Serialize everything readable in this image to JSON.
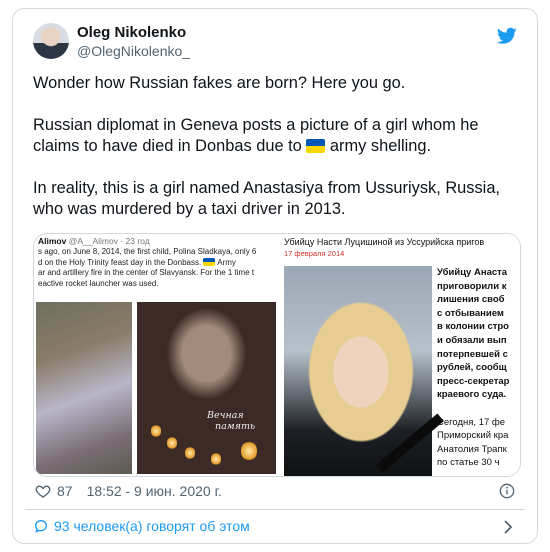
{
  "author": {
    "name": "Oleg Nikolenko",
    "handle": "@OlegNikolenko_"
  },
  "icons": {
    "platform": "twitter-bird-icon",
    "like": "heart-icon",
    "info": "info-icon",
    "replies": "speech-bubble-icon",
    "more": "chevron-right-icon"
  },
  "colors": {
    "accent": "#1d9bf0",
    "flag_top": "#0057b7",
    "flag_bottom": "#ffd700",
    "date_red": "#d0302a"
  },
  "tweet": {
    "p1": "Wonder how Russian fakes are born? Here you go.",
    "p2_before": "Russian diplomat in Geneva posts a picture of a girl whom he claims to have died in Donbas due to",
    "p2_after": "army shelling.",
    "p3": "In reality, this is a girl named Anastasiya from Ussuriysk, Russia, who was murdered by a taxi driver in 2013."
  },
  "media_left": {
    "author": "Alimov",
    "handle": "@A__Alimov · 23 год",
    "lines": [
      "s ago, on June 8, 2014, the first child, Polina Sladkaya, only 6",
      "d on the Holy Trinity feast day in the Donbass.",
      "Army",
      "ar and artillery fire in the center of Slavyansk. For the 1 time t",
      "eactive rocket launcher was used."
    ],
    "memory_line1": "Вечная",
    "memory_line2": "память"
  },
  "media_right": {
    "headline": "Убийцу Насти Луцишиной из Уссурийска пригов",
    "date": "17 февраля 2014",
    "lines": [
      "Убийцу Анаста",
      "приговорили к",
      "лишения своб",
      "с отбыванием",
      "в колонии стро",
      "и обязали вып",
      "потерпевшей с",
      "рублей, сообщ",
      "пресс-секретар",
      "краевого суда.",
      "",
      "Сегодня, 17 фе",
      "Приморский кра",
      "Анатолия Трапк",
      "по статье 30 ч"
    ],
    "bold_count": 10
  },
  "stats": {
    "likes": "87",
    "timestamp": "18:52 - 9 июн. 2020 г."
  },
  "footer": {
    "discussion": "93 человек(а) говорят об этом"
  }
}
